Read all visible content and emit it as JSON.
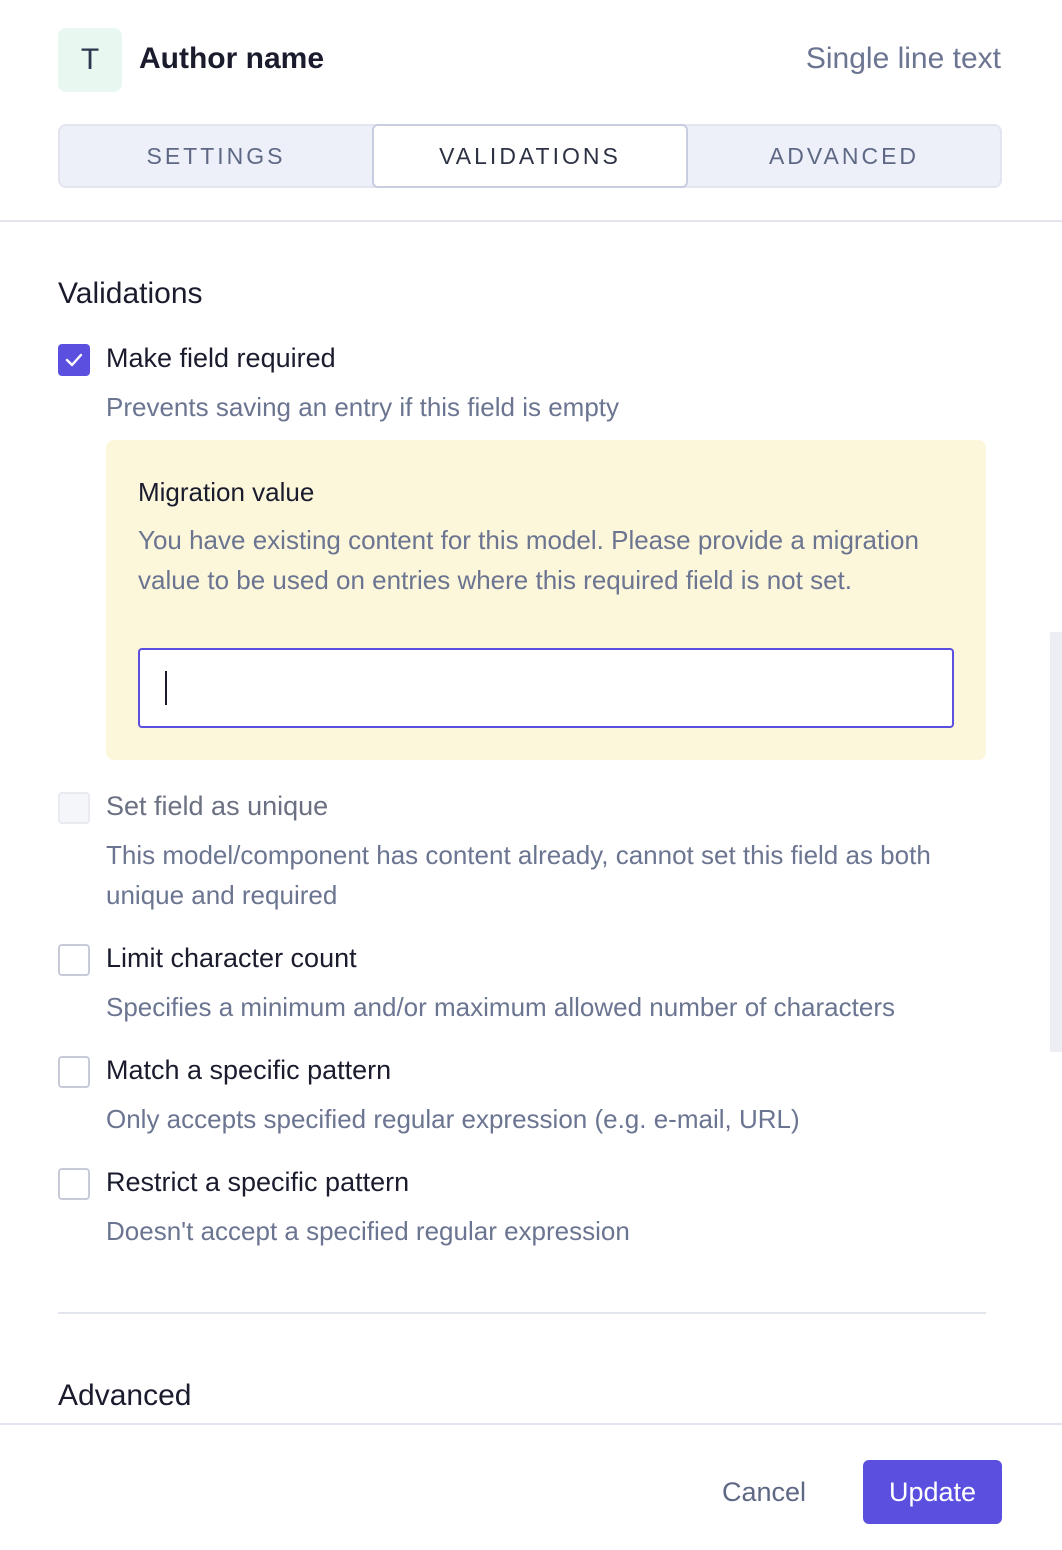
{
  "header": {
    "type_badge": "T",
    "field_name": "Author name",
    "field_type": "Single line text"
  },
  "tabs": [
    {
      "label": "SETTINGS",
      "active": false
    },
    {
      "label": "VALIDATIONS",
      "active": true
    },
    {
      "label": "ADVANCED",
      "active": false
    }
  ],
  "validations": {
    "title": "Validations",
    "required": {
      "checked": true,
      "label": "Make field required",
      "description": "Prevents saving an entry if this field is empty"
    },
    "migration": {
      "title": "Migration value",
      "description": "You have existing content for this model. Please provide a migration value to be used on entries where this required field is not set.",
      "value": ""
    },
    "unique": {
      "checked": false,
      "disabled": true,
      "label": "Set field as unique",
      "description": "This model/component has content already, cannot set this field as both unique and required"
    },
    "limit": {
      "checked": false,
      "label": "Limit character count",
      "description": "Specifies a minimum and/or maximum allowed number of characters"
    },
    "match": {
      "checked": false,
      "label": "Match a specific pattern",
      "description": "Only accepts specified regular expression (e.g. e-mail, URL)"
    },
    "restrict": {
      "checked": false,
      "label": "Restrict a specific pattern",
      "description": "Doesn't accept a specified regular expression"
    }
  },
  "advanced": {
    "title": "Advanced"
  },
  "footer": {
    "cancel_label": "Cancel",
    "update_label": "Update"
  },
  "colors": {
    "accent": "#5b4fe0",
    "migration_bg": "#fcf6da",
    "muted_text": "#6b7591"
  }
}
